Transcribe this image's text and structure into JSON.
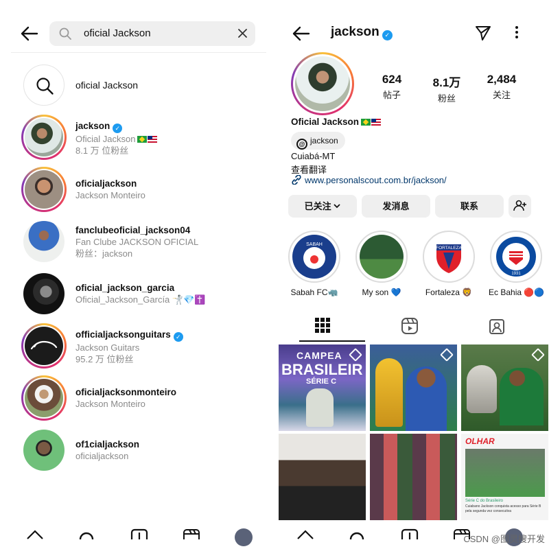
{
  "search": {
    "query": "oficial Jackson",
    "suggestion": "oficial Jackson",
    "results": [
      {
        "username": "jackson",
        "verified": true,
        "line2": "Oficial Jackson",
        "line2_flags": true,
        "line3": "8.1 万 位粉丝"
      },
      {
        "username": "oficialjackson",
        "verified": false,
        "line2": "Jackson Monteiro",
        "line3": ""
      },
      {
        "username": "fanclubeoficial_jackson04",
        "verified": false,
        "line2": "Fan Clube JACKSON OFICIAL",
        "line3": "粉丝：jackson"
      },
      {
        "username": "oficial_jackson_garcia",
        "verified": false,
        "line2": "Oficial_Jackson_García 🤺💎✝️",
        "line3": ""
      },
      {
        "username": "officialjacksonguitars",
        "verified": true,
        "line2": "Jackson Guitars",
        "line3": "95.2 万 位粉丝"
      },
      {
        "username": "oficialjacksonmonteiro",
        "verified": false,
        "line2": "Jackson Monteiro",
        "line3": ""
      },
      {
        "username": "of1cialjackson",
        "verified": false,
        "line2": "oficialjackson",
        "line3": ""
      }
    ]
  },
  "profile": {
    "username": "jackson",
    "verified": true,
    "posts_count": "624",
    "posts_label": "帖子",
    "followers_count": "8.1万",
    "followers_label": "粉丝",
    "following_count": "2,484",
    "following_label": "关注",
    "full_name": "Oficial Jackson",
    "threads_handle": "jackson",
    "bio_location": "Cuiabá-MT",
    "translate_label": "查看翻译",
    "website": "www.personalscout.com.br/jackson/",
    "following_button": "已关注",
    "message_button": "发消息",
    "contact_button": "联系",
    "highlights": [
      {
        "label": "Sabah FC🦏",
        "icon": "sabah-fc-crest"
      },
      {
        "label": "My son 💙",
        "icon": "soccer-field-photo"
      },
      {
        "label": "Fortaleza 🦁",
        "icon": "fortaleza-crest"
      },
      {
        "label": "Ec Bahia 🔴🔵",
        "icon": "ec-bahia-crest"
      }
    ],
    "highlight_crest_text": {
      "sabah": "SABAH",
      "fortaleza": "FORTALEZA",
      "bahia_year": "1931"
    },
    "post_texts": {
      "banner_top": "CAMPEA",
      "banner_mid": "BRASILEIR",
      "banner_bot": "SÉRIE C",
      "olhar": "OLHAR",
      "news_line1": "Série C do Brasileiro",
      "news_line2": "Cuiabano Jackson conquista acesso para Série B pela segunda vez consecutiva"
    }
  },
  "watermark": "CSDN @图灵搜开发",
  "colors": {
    "verified": "#1d9bf0",
    "link": "#00376b",
    "button_bg": "#efefef"
  }
}
